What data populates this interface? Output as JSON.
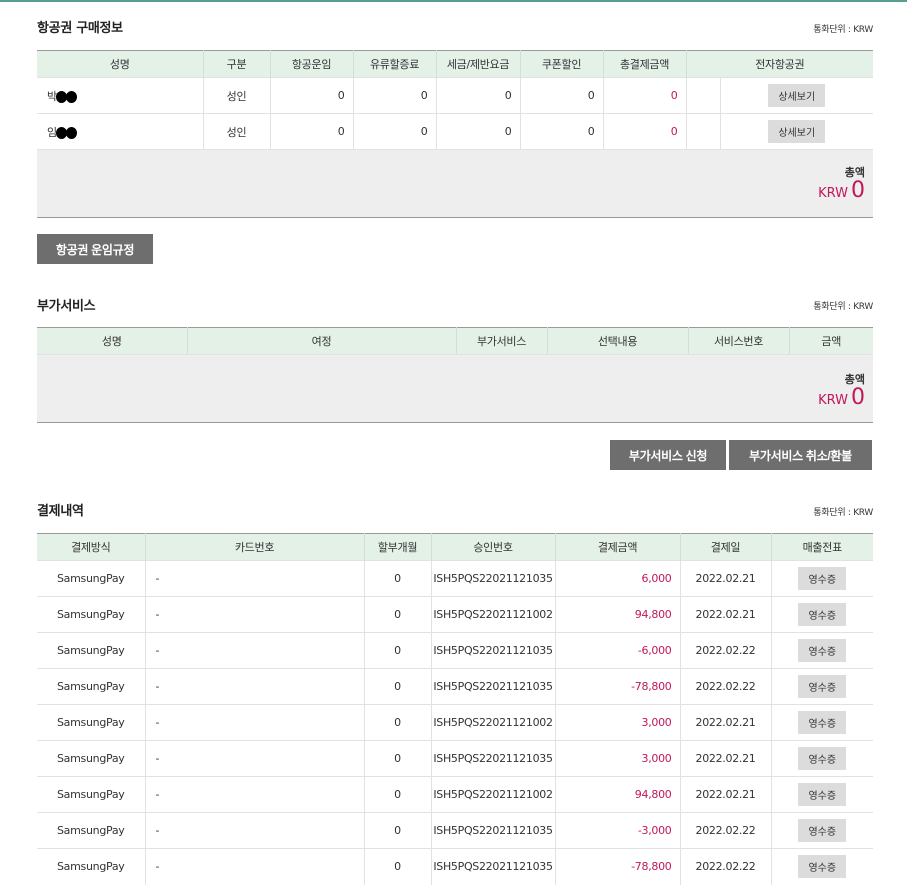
{
  "colors": {
    "header_bg": "#e3f1e6",
    "accent_pink": "#c2185b",
    "button_dark": "#6e6e6e",
    "top_line": "#5a9e91"
  },
  "ticket": {
    "title": "항공권 구매정보",
    "currency_unit": "통화단위 : KRW",
    "headers": [
      "성명",
      "구분",
      "항공운임",
      "유류할증료",
      "세금/제반요금",
      "쿠폰할인",
      "총결제금액",
      "전자항공권"
    ],
    "rows": [
      {
        "name": "박",
        "type": "성인",
        "fare": "0",
        "fuel": "0",
        "tax": "0",
        "coupon": "0",
        "total": "0",
        "btn": "상세보기"
      },
      {
        "name": "임",
        "type": "성인",
        "fare": "0",
        "fuel": "0",
        "tax": "0",
        "coupon": "0",
        "total": "0",
        "btn": "상세보기"
      }
    ],
    "total_label": "총액",
    "total_currency": "KRW",
    "total_value": "0",
    "rules_button": "항공권 운임규정"
  },
  "addon": {
    "title": "부가서비스",
    "currency_unit": "통화단위 : KRW",
    "headers": [
      "성명",
      "여정",
      "부가서비스",
      "선택내용",
      "서비스번호",
      "금액"
    ],
    "total_label": "총액",
    "total_currency": "KRW",
    "total_value": "0",
    "apply_button": "부가서비스 신청",
    "cancel_button": "부가서비스 취소/환불"
  },
  "payment": {
    "title": "결제내역",
    "currency_unit": "통화단위 : KRW",
    "headers": [
      "결제방식",
      "카드번호",
      "할부개월",
      "승인번호",
      "결제금액",
      "결제일",
      "매출전표"
    ],
    "rows": [
      {
        "method": "SamsungPay",
        "card": "-",
        "months": "0",
        "approval": "ISH5PQS22021121035",
        "amount": "6,000",
        "date": "2022.02.21",
        "receipt": "영수증"
      },
      {
        "method": "SamsungPay",
        "card": "-",
        "months": "0",
        "approval": "ISH5PQS22021121002",
        "amount": "94,800",
        "date": "2022.02.21",
        "receipt": "영수증"
      },
      {
        "method": "SamsungPay",
        "card": "-",
        "months": "0",
        "approval": "ISH5PQS22021121035",
        "amount": "-6,000",
        "date": "2022.02.22",
        "receipt": "영수증"
      },
      {
        "method": "SamsungPay",
        "card": "-",
        "months": "0",
        "approval": "ISH5PQS22021121035",
        "amount": "-78,800",
        "date": "2022.02.22",
        "receipt": "영수증"
      },
      {
        "method": "SamsungPay",
        "card": "-",
        "months": "0",
        "approval": "ISH5PQS22021121002",
        "amount": "3,000",
        "date": "2022.02.21",
        "receipt": "영수증"
      },
      {
        "method": "SamsungPay",
        "card": "-",
        "months": "0",
        "approval": "ISH5PQS22021121035",
        "amount": "3,000",
        "date": "2022.02.21",
        "receipt": "영수증"
      },
      {
        "method": "SamsungPay",
        "card": "-",
        "months": "0",
        "approval": "ISH5PQS22021121002",
        "amount": "94,800",
        "date": "2022.02.21",
        "receipt": "영수증"
      },
      {
        "method": "SamsungPay",
        "card": "-",
        "months": "0",
        "approval": "ISH5PQS22021121035",
        "amount": "-3,000",
        "date": "2022.02.22",
        "receipt": "영수증"
      },
      {
        "method": "SamsungPay",
        "card": "-",
        "months": "0",
        "approval": "ISH5PQS22021121035",
        "amount": "-78,800",
        "date": "2022.02.22",
        "receipt": "영수증"
      }
    ]
  }
}
